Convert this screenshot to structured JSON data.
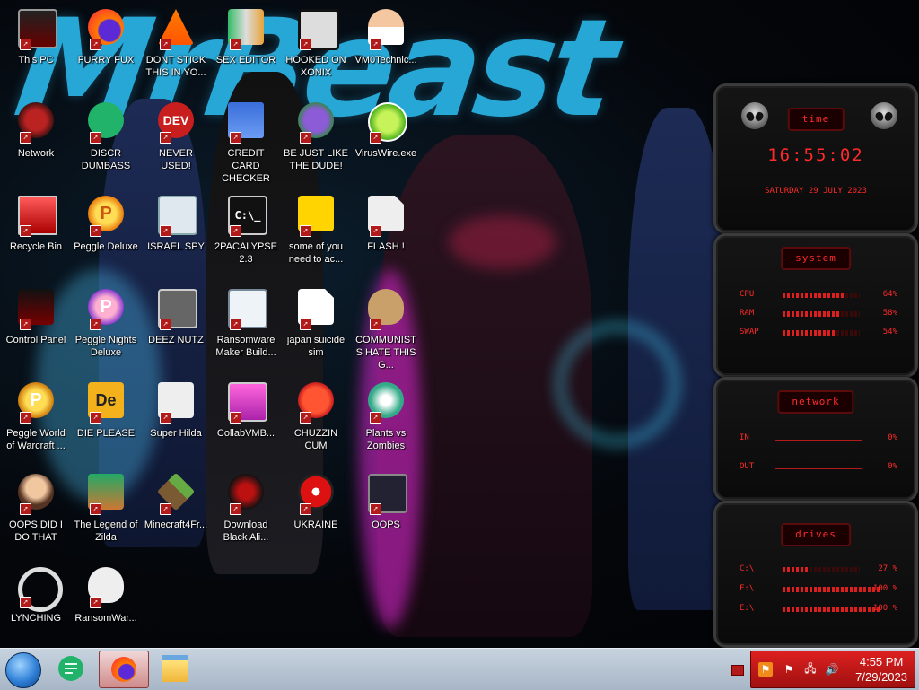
{
  "wallpaper": {
    "title_text": "MrBeast"
  },
  "desktop_icons": [
    {
      "label": "This PC",
      "icon": "computer-icon"
    },
    {
      "label": "FURRY FUX",
      "icon": "firefox-icon"
    },
    {
      "label": "DONT STICK THIS IN YO...",
      "icon": "vlc-cone-icon"
    },
    {
      "label": "SEX EDITOR",
      "icon": "hex-editor-icon"
    },
    {
      "label": "HOOKED ON XONIX",
      "icon": "xonix-game-icon"
    },
    {
      "label": "VM0Technic...",
      "icon": "doctor-avatar-icon"
    },
    {
      "label": "Network",
      "icon": "network-icon"
    },
    {
      "label": "DISCR DUMBASS",
      "icon": "discord-icon"
    },
    {
      "label": "NEVER USED!",
      "icon": "dev-cpp-icon"
    },
    {
      "label": "CREDIT CARD CHECKER",
      "icon": "credit-card-icon"
    },
    {
      "label": "BE JUST LIKE THE DUDE!",
      "icon": "bonzi-santa-icon"
    },
    {
      "label": "VirusWire.exe",
      "icon": "lime-icon"
    },
    {
      "label": "Recycle Bin",
      "icon": "recycle-bin-icon"
    },
    {
      "label": "Peggle Deluxe",
      "icon": "peggle-icon"
    },
    {
      "label": "ISRAEL SPY",
      "icon": "spy-tool-icon"
    },
    {
      "label": "2PACALYPSE 2.3",
      "icon": "terminal-icon"
    },
    {
      "label": "some of you need to ac...",
      "icon": "dog-icon"
    },
    {
      "label": "FLASH !",
      "icon": "flash-doc-icon"
    },
    {
      "label": "Control Panel",
      "icon": "control-panel-icon"
    },
    {
      "label": "Peggle Nights Deluxe",
      "icon": "peggle-nights-icon"
    },
    {
      "label": "DEEZ NUTZ",
      "icon": "windows-stack-icon"
    },
    {
      "label": "Ransomware Maker Build...",
      "icon": "window-app-icon"
    },
    {
      "label": "japan suicide sim",
      "icon": "document-icon"
    },
    {
      "label": "COMMUNISTS HATE THIS G...",
      "icon": "money-bag-icon"
    },
    {
      "label": "Peggle World of Warcraft ...",
      "icon": "peggle-wow-icon"
    },
    {
      "label": "DIE PLEASE",
      "icon": "director-icon"
    },
    {
      "label": "Super Hilda",
      "icon": "pixel-cat-icon"
    },
    {
      "label": "CollabVMB...",
      "icon": "collab-vm-icon"
    },
    {
      "label": "CHUZZIN CUM",
      "icon": "chuzzle-icon"
    },
    {
      "label": "Plants vs Zombies",
      "icon": "plants-icon"
    },
    {
      "label": "OOPS DID I DO THAT",
      "icon": "portrait-icon"
    },
    {
      "label": "The Legend of Zilda",
      "icon": "zelda-icon"
    },
    {
      "label": "Minecraft4Fr...",
      "icon": "minecraft-icon"
    },
    {
      "label": "Download Black Ali...",
      "icon": "black-orb-icon"
    },
    {
      "label": "UKRAINE",
      "icon": "radiation-icon"
    },
    {
      "label": "OOPS",
      "icon": "monitor-sign-icon"
    },
    {
      "label": "LYNCHING",
      "icon": "rope-icon"
    },
    {
      "label": "RansomWar...",
      "icon": "skull-icon"
    }
  ],
  "gadgets": {
    "time": {
      "title": "time",
      "clock": "16:55:02",
      "date": "saturday 29 july 2023"
    },
    "system": {
      "title": "system",
      "rows": [
        {
          "label": "CPU",
          "value": "64%",
          "level": 0.64
        },
        {
          "label": "RAM",
          "value": "58%",
          "level": 0.58
        },
        {
          "label": "SWAP",
          "value": "54%",
          "level": 0.54
        }
      ]
    },
    "network": {
      "title": "network",
      "rows": [
        {
          "label": "IN",
          "value": "0%"
        },
        {
          "label": "OUT",
          "value": "0%"
        }
      ]
    },
    "drives": {
      "title": "drives",
      "rows": [
        {
          "label": "C:\\",
          "value": "27 %",
          "level": 0.27
        },
        {
          "label": "F:\\",
          "value": "100 %",
          "level": 1.0
        },
        {
          "label": "E:\\",
          "value": "100 %",
          "level": 1.0
        }
      ]
    }
  },
  "taskbar": {
    "pinned": [
      {
        "icon": "discord-icon",
        "active": false
      },
      {
        "icon": "firefox-icon",
        "active": true
      },
      {
        "icon": "file-explorer-icon",
        "active": false
      }
    ],
    "clock_time": "4:55 PM",
    "clock_date": "7/29/2023",
    "tray_icons": [
      "flag-icon",
      "network-tray-icon",
      "volume-icon"
    ]
  }
}
